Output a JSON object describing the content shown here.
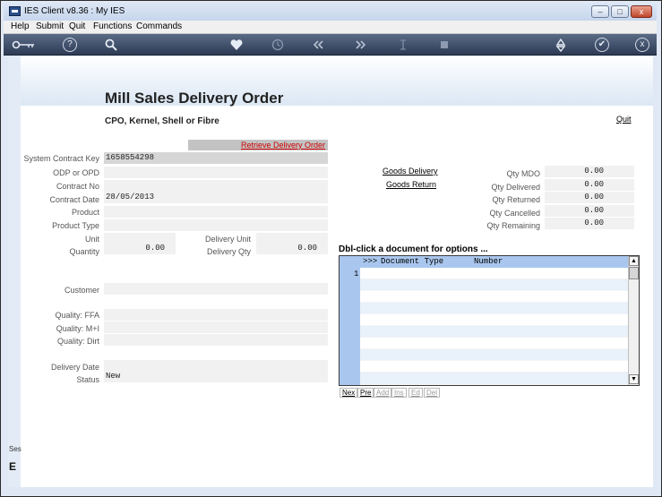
{
  "window": {
    "title": "IES Client v8.36 : My IES",
    "controls": {
      "minimize": "–",
      "maximize": "□",
      "close": "x"
    }
  },
  "menu": [
    "Help",
    "Submit",
    "Quit",
    "Functions",
    "Commands"
  ],
  "toolbar": {
    "icons": [
      "key-icon",
      "help-icon",
      "search-icon",
      "heart-icon",
      "clock-icon",
      "rewind-icon",
      "fast-forward-icon",
      "text-cursor-icon",
      "stop-icon",
      "recycle-icon",
      "check-icon",
      "close-icon"
    ],
    "help_glyph": "?",
    "check_glyph": "✔",
    "close_glyph": "x"
  },
  "page": {
    "title": "Mill Sales Delivery Order",
    "subtitle": "CPO, Kernel, Shell or Fibre",
    "quit_link": "Quit",
    "retrieve_button": "Retrieve Delivery Order"
  },
  "form": {
    "system_contract_key": {
      "label": "System Contract Key",
      "value": "1658554298"
    },
    "odp_or_opd": {
      "label": "ODP or OPD",
      "value": ""
    },
    "contract_no": {
      "label": "Contract No",
      "value": ""
    },
    "contract_date": {
      "label": "Contract Date",
      "value": "28/05/2013"
    },
    "product": {
      "label": "Product",
      "value": ""
    },
    "product_type": {
      "label": "Product Type",
      "value": ""
    },
    "unit": {
      "label": "Unit",
      "value": ""
    },
    "quantity": {
      "label": "Quantity",
      "value": "0.00"
    },
    "delivery_unit": {
      "label": "Delivery Unit",
      "value": ""
    },
    "delivery_qty": {
      "label": "Delivery Qty",
      "value": "0.00"
    },
    "customer": {
      "label": "Customer",
      "value": ""
    },
    "quality_ffa": {
      "label": "Quality: FFA",
      "value": ""
    },
    "quality_mi": {
      "label": "Quality: M+I",
      "value": ""
    },
    "quality_dirt": {
      "label": "Quality: Dirt",
      "value": ""
    },
    "delivery_date": {
      "label": "Delivery Date",
      "value": ""
    },
    "status": {
      "label": "Status",
      "value": "New"
    }
  },
  "links": {
    "goods_delivery": "Goods Delivery",
    "goods_return": "Goods Return"
  },
  "quantities": {
    "qty_mdo": {
      "label": "Qty MDO",
      "value": "0.00"
    },
    "qty_delivered": {
      "label": "Qty Delivered",
      "value": "0.00"
    },
    "qty_returned": {
      "label": "Qty Returned",
      "value": "0.00"
    },
    "qty_cancelled": {
      "label": "Qty Cancelled",
      "value": "0.00"
    },
    "qty_remaining": {
      "label": "Qty Remaining",
      "value": "0.00"
    }
  },
  "grid": {
    "title": "Dbl-click a document for options ...",
    "header_marker": ">>>",
    "columns": [
      "Document Type",
      "Number"
    ],
    "row_numbers": [
      "1"
    ],
    "buttons": [
      "Nex",
      "Pre",
      "Add",
      "Ins",
      "Ed",
      "Del"
    ],
    "scroll_up": "▲",
    "scroll_down": "▼"
  },
  "status_stub": {
    "label": "Ses",
    "glyph": "E"
  }
}
